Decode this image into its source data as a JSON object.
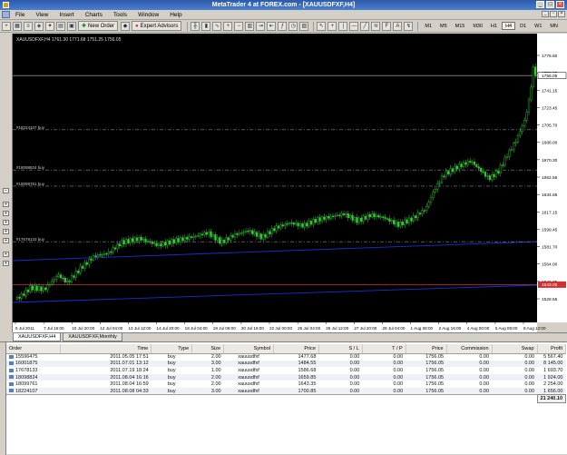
{
  "window": {
    "title": "MetaTrader 4 at FOREX.com - [XAUUSDFXF,H4]"
  },
  "menu": [
    "File",
    "View",
    "Insert",
    "Charts",
    "Tools",
    "Window",
    "Help"
  ],
  "toolbar": {
    "new_order": "New Order",
    "expert_advisors": "Expert Advisors",
    "timeframes": [
      "M1",
      "M5",
      "M15",
      "M30",
      "H1",
      "H4",
      "D1",
      "W1",
      "MN"
    ],
    "active_timeframe": "H4"
  },
  "chart": {
    "header": "XAUUSDFXF,H4  1761.30 1771.68 1751.25 1756.05",
    "price_labels": [
      "1776.60",
      "1758.85",
      "1741.15",
      "1723.45",
      "1705.70",
      "1688.00",
      "1670.30",
      "1652.55",
      "1634.85",
      "1617.15",
      "1599.45",
      "1581.70",
      "1564.00",
      "1546.25",
      "1528.55"
    ],
    "current_price": "1756.05",
    "red_line_price": "1543.00",
    "date_labels": [
      "6 Jul 2011",
      "7 Jul 16:00",
      "10 Jul 20:00",
      "12 Jul 04:00",
      "13 Jul 12:00",
      "14 Jul 20:00",
      "18 Jul 04:00",
      "19 Jul 08:00",
      "20 Jul 16:00",
      "22 Jul 00:00",
      "25 Jul 04:00",
      "26 Jul 12:00",
      "27 Jul 20:00",
      "29 Jul 04:00",
      "1 Aug 08:00",
      "2 Aug 16:00",
      "4 Aug 00:00",
      "5 Aug 08:00",
      "8 Aug 12:00"
    ],
    "order_lines": [
      {
        "label": "#18224107 buy",
        "price": 1700.85
      },
      {
        "label": "#18098824 buy",
        "price": 1659.85
      },
      {
        "label": "#18099761 buy",
        "price": 1643.35
      },
      {
        "label": "#17678133 buy",
        "price": 1586.68
      }
    ],
    "colors": {
      "background": "#000000",
      "candle": "#33cc33",
      "trend": "#1a2fd0",
      "level": "#d03030",
      "order_line": "#8a8a8a"
    }
  },
  "chart_tabs": [
    {
      "label": "XAUUSDFXF,H4",
      "active": true
    },
    {
      "label": "XAUUSDFXF,Monthly",
      "active": false
    }
  ],
  "orders": {
    "columns": [
      "Order",
      "Time",
      "Type",
      "Size",
      "Symbol",
      "Price",
      "S / L",
      "T / P",
      "Price",
      "Commission",
      "Swap",
      "Profit"
    ],
    "rows": [
      [
        "15596475",
        "2011.05.05 17:51",
        "buy",
        "2.00",
        "xauusdfxf",
        "1477.68",
        "0.00",
        "0.00",
        "1756.05",
        "0.00",
        "0.00",
        "5 567.40"
      ],
      [
        "16001875",
        "2011.07.01 13:12",
        "buy",
        "3.00",
        "xauusdfxf",
        "1484.55",
        "0.00",
        "0.00",
        "1756.05",
        "0.00",
        "0.00",
        "8 145.00"
      ],
      [
        "17678133",
        "2011.07.19 18:24",
        "buy",
        "1.00",
        "xauusdfxf",
        "1586.68",
        "0.00",
        "0.00",
        "1756.05",
        "0.00",
        "0.00",
        "1 693.70"
      ],
      [
        "18098824",
        "2011.08.04 16:16",
        "buy",
        "2.00",
        "xauusdfxf",
        "1659.85",
        "0.00",
        "0.00",
        "1756.05",
        "0.00",
        "0.00",
        "1 924.00"
      ],
      [
        "18099761",
        "2011.08.04 16:59",
        "buy",
        "2.00",
        "xauusdfxf",
        "1643.35",
        "0.00",
        "0.00",
        "1756.05",
        "0.00",
        "0.00",
        "2 254.00"
      ],
      [
        "18224107",
        "2011.08.08 04:33",
        "buy",
        "3.00",
        "xauusdfxf",
        "1700.85",
        "0.00",
        "0.00",
        "1756.05",
        "0.00",
        "0.00",
        "1 656.00"
      ]
    ],
    "total": "21 240.10"
  }
}
